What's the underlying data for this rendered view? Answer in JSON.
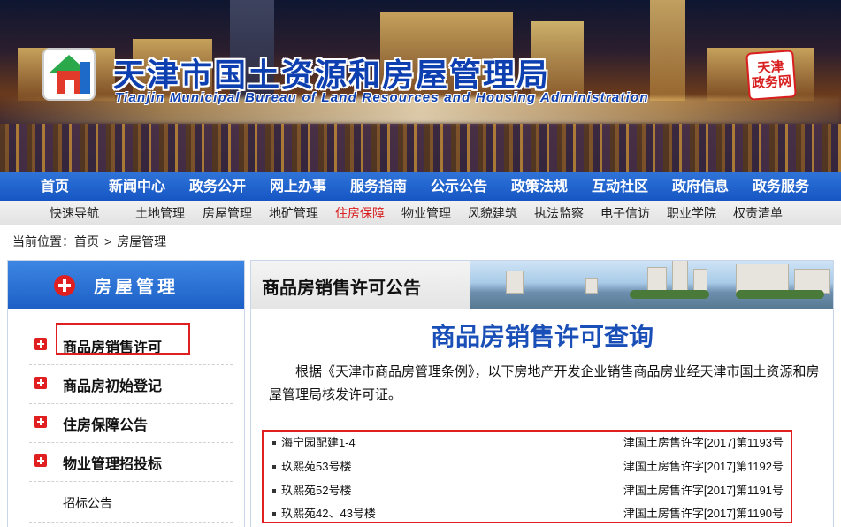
{
  "header": {
    "title_cn": "天津市国土资源和房屋管理局",
    "title_en": "Tianjin Municipal Bureau of Land Resources and Housing Administration",
    "seal_text": "天津\n政务网"
  },
  "main_nav": {
    "items": [
      "首页",
      "新闻中心",
      "政务公开",
      "网上办事",
      "服务指南",
      "公示公告",
      "政策法规",
      "互动社区",
      "政府信息",
      "政务服务"
    ]
  },
  "sub_nav": {
    "items": [
      "快速导航",
      "土地管理",
      "房屋管理",
      "地矿管理",
      "住房保障",
      "物业管理",
      "风貌建筑",
      "执法监察",
      "电子信访",
      "职业学院",
      "权责清单"
    ],
    "active": "住房保障"
  },
  "breadcrumb": {
    "prefix": "当前位置：",
    "home": "首页",
    "separator": ">",
    "current": "房屋管理"
  },
  "sidebar": {
    "title": "房屋管理",
    "items": [
      {
        "label": "商品房销售许可"
      },
      {
        "label": "商品房初始登记"
      },
      {
        "label": "住房保障公告"
      },
      {
        "label": "物业管理招投标"
      },
      {
        "label": "招标公告"
      }
    ]
  },
  "content": {
    "header_title": "商品房销售许可公告",
    "title": "商品房销售许可查询",
    "intro": "根据《天津市商品房管理条例》，以下房地产开发企业销售商品房业经天津市国土资源和房屋管理局核发许可证。",
    "permits": [
      {
        "name": "海宁园配建1-4",
        "number": "津国土房售许字[2017]第1193号"
      },
      {
        "name": "玖熙苑53号楼",
        "number": "津国土房售许字[2017]第1192号"
      },
      {
        "name": "玖熙苑52号楼",
        "number": "津国土房售许字[2017]第1191号"
      },
      {
        "name": "玖熙苑42、43号楼",
        "number": "津国土房售许字[2017]第1190号"
      }
    ]
  },
  "colors": {
    "nav_blue": "#1656c4",
    "title_blue": "#1a4fb8",
    "highlight_red": "#e02020"
  }
}
